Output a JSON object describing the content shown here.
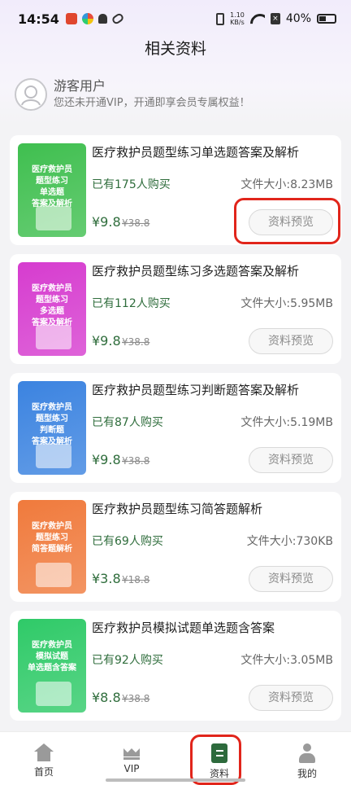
{
  "status_bar": {
    "time": "14:54",
    "speed_top": "1.10",
    "speed_unit": "KB/s",
    "battery": "40%"
  },
  "header": {
    "title": "相关资料"
  },
  "user": {
    "name": "游客用户",
    "subtitle": "您还未开通VIP，开通即享会员专属权益！"
  },
  "items": [
    {
      "thumb_lines": [
        "医疗救护员",
        "题型练习",
        "单选题",
        "答案及解析"
      ],
      "thumb_color": "#3fbf4f",
      "title": "医疗救护员题型练习单选题答案及解析",
      "bought": "已有175人购买",
      "size": "文件大小:8.23MB",
      "price": "¥9.8",
      "old_price": "¥38.8",
      "button": "资料预览"
    },
    {
      "thumb_lines": [
        "医疗救护员",
        "题型练习",
        "多选题",
        "答案及解析"
      ],
      "thumb_color": "#d63ccf",
      "title": "医疗救护员题型练习多选题答案及解析",
      "bought": "已有112人购买",
      "size": "文件大小:5.95MB",
      "price": "¥9.8",
      "old_price": "¥38.8",
      "button": "资料预览"
    },
    {
      "thumb_lines": [
        "医疗救护员",
        "题型练习",
        "判断题",
        "答案及解析"
      ],
      "thumb_color": "#3b83e0",
      "title": "医疗救护员题型练习判断题答案及解析",
      "bought": "已有87人购买",
      "size": "文件大小:5.19MB",
      "price": "¥9.8",
      "old_price": "¥38.8",
      "button": "资料预览"
    },
    {
      "thumb_lines": [
        "医疗救护员",
        "题型练习",
        "简答题解析"
      ],
      "thumb_color": "#f07a3c",
      "title": "医疗救护员题型练习简答题解析",
      "bought": "已有69人购买",
      "size": "文件大小:730KB",
      "price": "¥3.8",
      "old_price": "¥18.8",
      "button": "资料预览"
    },
    {
      "thumb_lines": [
        "医疗救护员",
        "模拟试题",
        "单选题含答案"
      ],
      "thumb_color": "#2fca68",
      "title": "医疗救护员模拟试题单选题含答案",
      "bought": "已有92人购买",
      "size": "文件大小:3.05MB",
      "price": "¥8.8",
      "old_price": "¥38.8",
      "button": "资料预览"
    }
  ],
  "nav": {
    "home": "首页",
    "vip": "VIP",
    "docs": "资料",
    "me": "我的"
  },
  "colors": {
    "accent_green": "#2f6d3c",
    "highlight_red": "#e1251b"
  }
}
